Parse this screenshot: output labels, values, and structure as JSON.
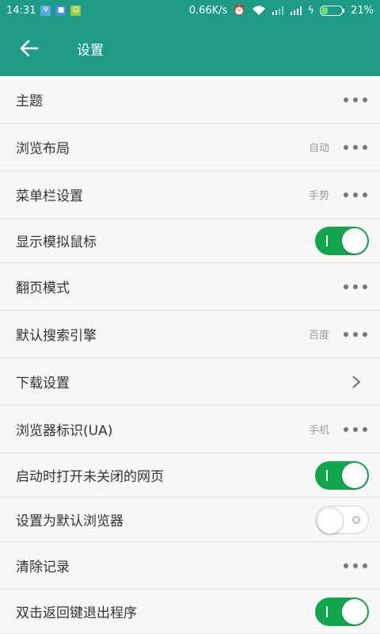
{
  "status": {
    "time": "14:31",
    "speed": "0.66K/s",
    "battery": "21%"
  },
  "appbar": {
    "title": "设置"
  },
  "rows": [
    {
      "label": "主题",
      "value": "",
      "control": "dots"
    },
    {
      "label": "浏览布局",
      "value": "自动",
      "control": "dots"
    },
    {
      "label": "菜单栏设置",
      "value": "手势",
      "control": "dots"
    },
    {
      "label": "显示模拟鼠标",
      "value": "",
      "control": "switch",
      "on": true
    },
    {
      "label": "翻页模式",
      "value": "",
      "control": "dots"
    },
    {
      "label": "默认搜索引擎",
      "value": "百度",
      "control": "dots"
    },
    {
      "label": "下载设置",
      "value": "",
      "control": "chevron"
    },
    {
      "label": "浏览器标识(UA)",
      "value": "手机",
      "control": "dots"
    },
    {
      "label": "启动时打开未关闭的网页",
      "value": "",
      "control": "switch",
      "on": true
    },
    {
      "label": "设置为默认浏览器",
      "value": "",
      "control": "switch",
      "on": false
    },
    {
      "label": "清除记录",
      "value": "",
      "control": "dots"
    },
    {
      "label": "双击返回键退出程序",
      "value": "",
      "control": "switch",
      "on": true
    }
  ],
  "colors": {
    "primary": "#1e9b86",
    "switch_on": "#12a64e"
  }
}
